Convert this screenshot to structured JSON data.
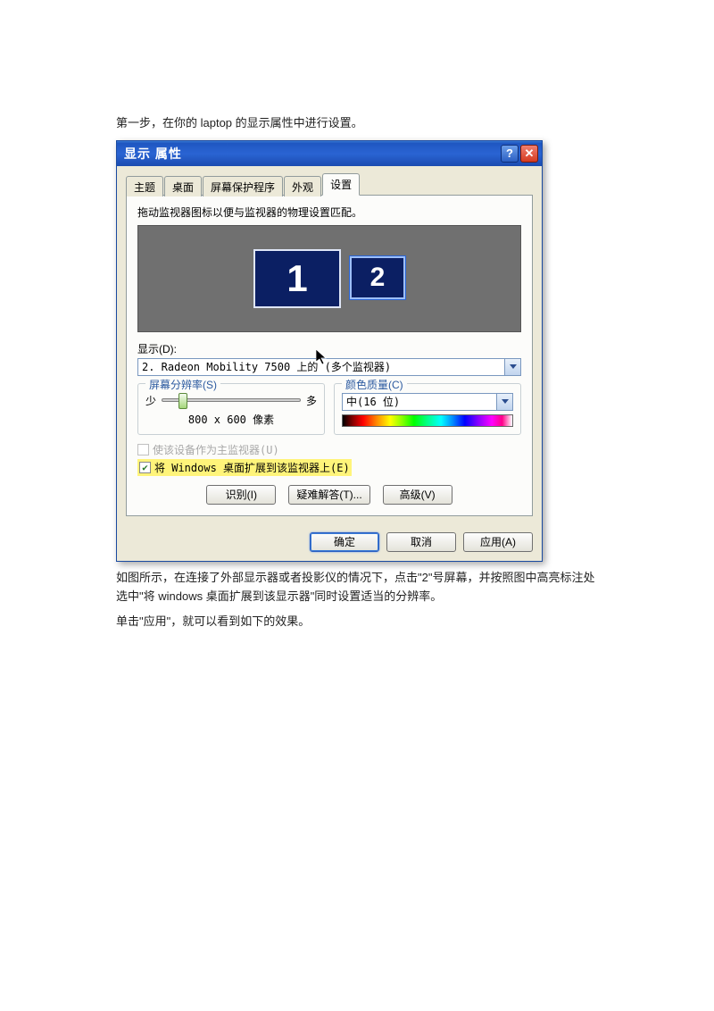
{
  "intro_text": "第一步，在你的 laptop 的显示属性中进行设置。",
  "outro_text_1": "如图所示，在连接了外部显示器或者投影仪的情况下，点击\"2\"号屏幕，并按照图中高亮标注处选中\"将 windows 桌面扩展到该显示器\"同时设置适当的分辨率。",
  "outro_text_2": "单击\"应用\"，就可以看到如下的效果。",
  "dialog": {
    "title": "显示 属性",
    "tabs": [
      "主题",
      "桌面",
      "屏幕保护程序",
      "外观",
      "设置"
    ],
    "active_tab": 4,
    "hint": "拖动监视器图标以便与监视器的物理设置匹配。",
    "monitors": {
      "m1": "1",
      "m2": "2"
    },
    "display_label": "显示(D):",
    "display_value": "2. Radeon Mobility 7500 上的 (多个监视器)",
    "resolution": {
      "legend": "屏幕分辨率(S)",
      "less": "少",
      "more": "多",
      "value": "800 x 600 像素"
    },
    "color": {
      "legend": "颜色质量(C)",
      "value": "中(16 位)"
    },
    "check_primary": "使该设备作为主监视器(U)",
    "check_extend": "将 Windows 桌面扩展到该监视器上(E)",
    "btn_identify": "识别(I)",
    "btn_trouble": "疑难解答(T)...",
    "btn_advanced": "高级(V)",
    "btn_ok": "确定",
    "btn_cancel": "取消",
    "btn_apply": "应用(A)"
  }
}
